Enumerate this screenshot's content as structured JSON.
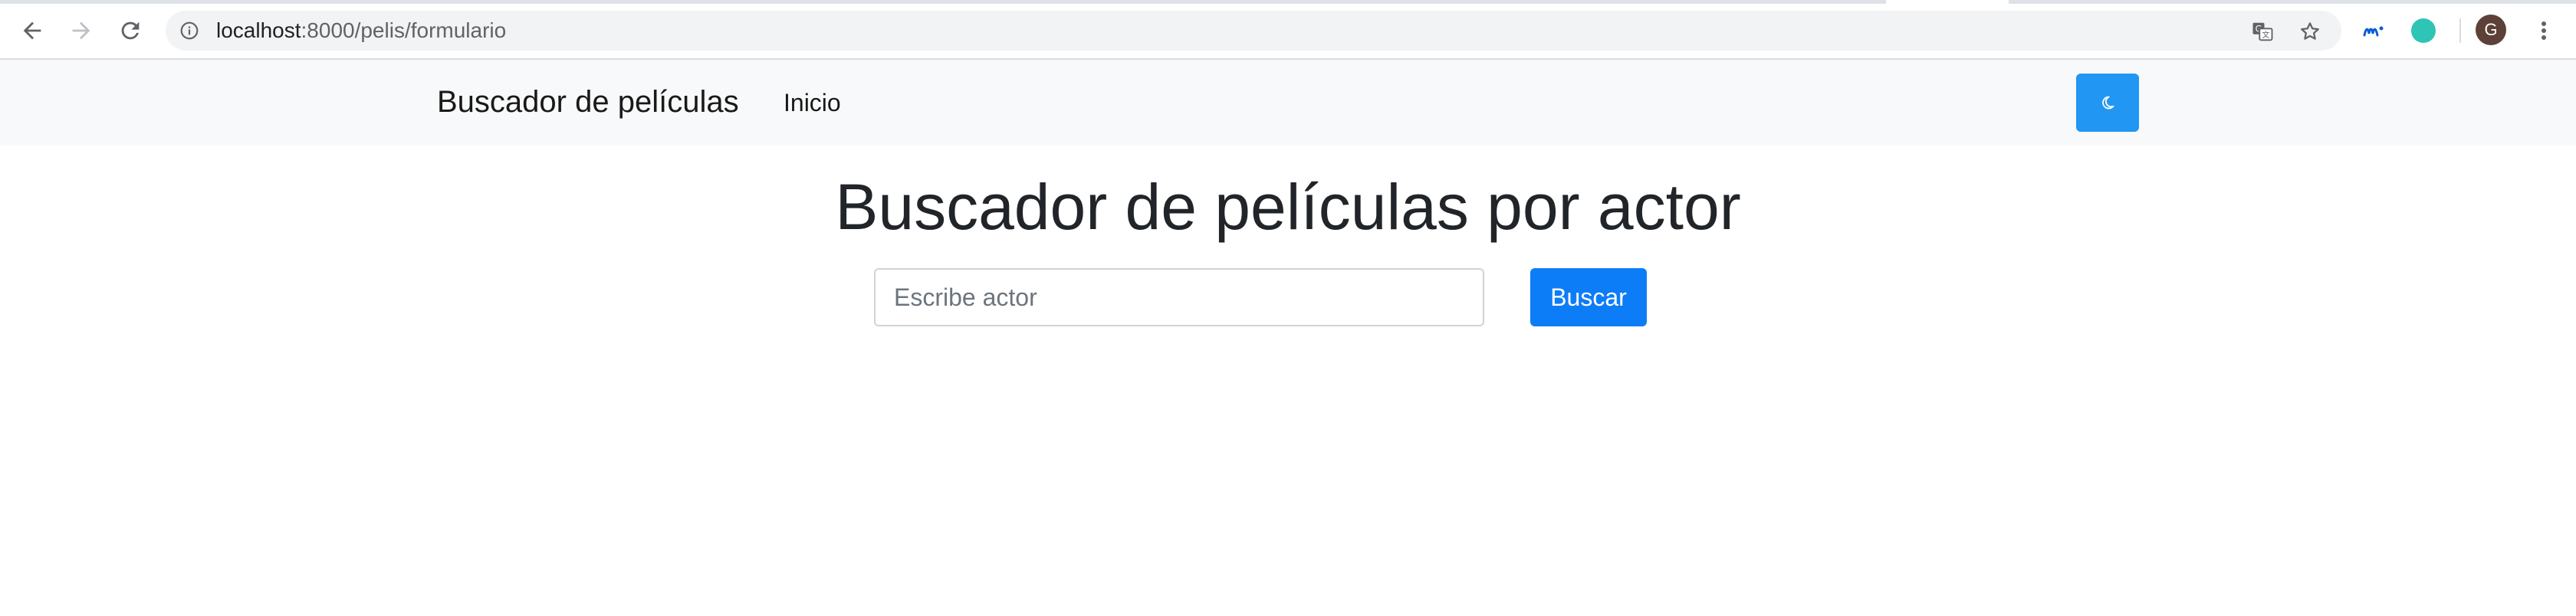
{
  "browser": {
    "url_host": "localhost",
    "url_path": ":8000/pelis/formulario",
    "avatar_initial": "G",
    "icons": {
      "back": "back-arrow-icon",
      "forward": "forward-arrow-icon",
      "reload": "reload-icon",
      "site_info": "info-icon",
      "translate": "translate-icon",
      "bookmark": "star-icon",
      "extension_1": "movistar-icon",
      "extension_2": "teal-circle-icon",
      "menu": "kebab-menu-icon"
    }
  },
  "navbar": {
    "brand": "Buscador de películas",
    "links": [
      {
        "label": "Inicio"
      }
    ],
    "theme_toggle_icon": "moon-icon",
    "background": "#f8f9fa",
    "toggle_color": "#2196f3"
  },
  "main": {
    "title": "Buscador de películas por actor",
    "search": {
      "placeholder": "Escribe actor",
      "value": "",
      "button_label": "Buscar",
      "button_color": "#0d7df7"
    }
  }
}
